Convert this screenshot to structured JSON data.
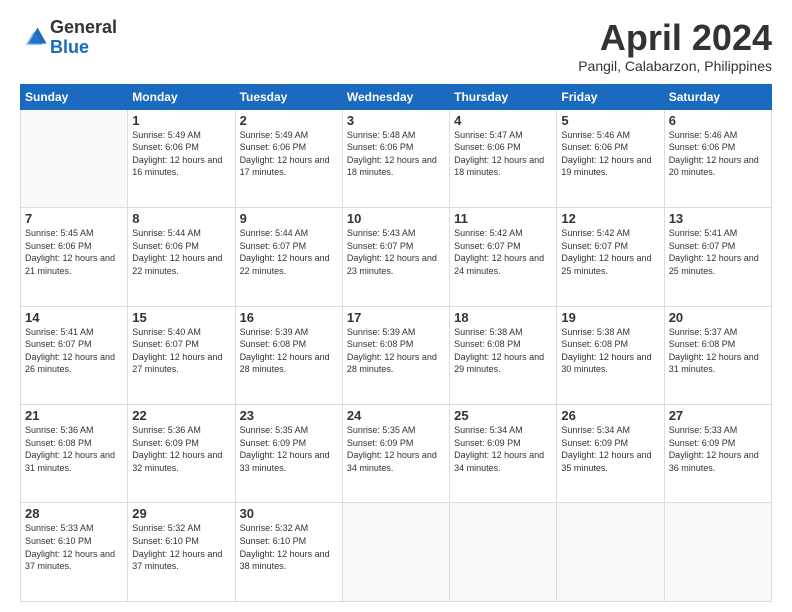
{
  "header": {
    "logo_general": "General",
    "logo_blue": "Blue",
    "month_title": "April 2024",
    "location": "Pangil, Calabarzon, Philippines"
  },
  "weekdays": [
    "Sunday",
    "Monday",
    "Tuesday",
    "Wednesday",
    "Thursday",
    "Friday",
    "Saturday"
  ],
  "weeks": [
    [
      {
        "day": "",
        "sunrise": "",
        "sunset": "",
        "daylight": ""
      },
      {
        "day": "1",
        "sunrise": "5:49 AM",
        "sunset": "6:06 PM",
        "daylight": "12 hours and 16 minutes."
      },
      {
        "day": "2",
        "sunrise": "5:49 AM",
        "sunset": "6:06 PM",
        "daylight": "12 hours and 17 minutes."
      },
      {
        "day": "3",
        "sunrise": "5:48 AM",
        "sunset": "6:06 PM",
        "daylight": "12 hours and 18 minutes."
      },
      {
        "day": "4",
        "sunrise": "5:47 AM",
        "sunset": "6:06 PM",
        "daylight": "12 hours and 18 minutes."
      },
      {
        "day": "5",
        "sunrise": "5:46 AM",
        "sunset": "6:06 PM",
        "daylight": "12 hours and 19 minutes."
      },
      {
        "day": "6",
        "sunrise": "5:46 AM",
        "sunset": "6:06 PM",
        "daylight": "12 hours and 20 minutes."
      }
    ],
    [
      {
        "day": "7",
        "sunrise": "5:45 AM",
        "sunset": "6:06 PM",
        "daylight": "12 hours and 21 minutes."
      },
      {
        "day": "8",
        "sunrise": "5:44 AM",
        "sunset": "6:06 PM",
        "daylight": "12 hours and 22 minutes."
      },
      {
        "day": "9",
        "sunrise": "5:44 AM",
        "sunset": "6:07 PM",
        "daylight": "12 hours and 22 minutes."
      },
      {
        "day": "10",
        "sunrise": "5:43 AM",
        "sunset": "6:07 PM",
        "daylight": "12 hours and 23 minutes."
      },
      {
        "day": "11",
        "sunrise": "5:42 AM",
        "sunset": "6:07 PM",
        "daylight": "12 hours and 24 minutes."
      },
      {
        "day": "12",
        "sunrise": "5:42 AM",
        "sunset": "6:07 PM",
        "daylight": "12 hours and 25 minutes."
      },
      {
        "day": "13",
        "sunrise": "5:41 AM",
        "sunset": "6:07 PM",
        "daylight": "12 hours and 25 minutes."
      }
    ],
    [
      {
        "day": "14",
        "sunrise": "5:41 AM",
        "sunset": "6:07 PM",
        "daylight": "12 hours and 26 minutes."
      },
      {
        "day": "15",
        "sunrise": "5:40 AM",
        "sunset": "6:07 PM",
        "daylight": "12 hours and 27 minutes."
      },
      {
        "day": "16",
        "sunrise": "5:39 AM",
        "sunset": "6:08 PM",
        "daylight": "12 hours and 28 minutes."
      },
      {
        "day": "17",
        "sunrise": "5:39 AM",
        "sunset": "6:08 PM",
        "daylight": "12 hours and 28 minutes."
      },
      {
        "day": "18",
        "sunrise": "5:38 AM",
        "sunset": "6:08 PM",
        "daylight": "12 hours and 29 minutes."
      },
      {
        "day": "19",
        "sunrise": "5:38 AM",
        "sunset": "6:08 PM",
        "daylight": "12 hours and 30 minutes."
      },
      {
        "day": "20",
        "sunrise": "5:37 AM",
        "sunset": "6:08 PM",
        "daylight": "12 hours and 31 minutes."
      }
    ],
    [
      {
        "day": "21",
        "sunrise": "5:36 AM",
        "sunset": "6:08 PM",
        "daylight": "12 hours and 31 minutes."
      },
      {
        "day": "22",
        "sunrise": "5:36 AM",
        "sunset": "6:09 PM",
        "daylight": "12 hours and 32 minutes."
      },
      {
        "day": "23",
        "sunrise": "5:35 AM",
        "sunset": "6:09 PM",
        "daylight": "12 hours and 33 minutes."
      },
      {
        "day": "24",
        "sunrise": "5:35 AM",
        "sunset": "6:09 PM",
        "daylight": "12 hours and 34 minutes."
      },
      {
        "day": "25",
        "sunrise": "5:34 AM",
        "sunset": "6:09 PM",
        "daylight": "12 hours and 34 minutes."
      },
      {
        "day": "26",
        "sunrise": "5:34 AM",
        "sunset": "6:09 PM",
        "daylight": "12 hours and 35 minutes."
      },
      {
        "day": "27",
        "sunrise": "5:33 AM",
        "sunset": "6:09 PM",
        "daylight": "12 hours and 36 minutes."
      }
    ],
    [
      {
        "day": "28",
        "sunrise": "5:33 AM",
        "sunset": "6:10 PM",
        "daylight": "12 hours and 37 minutes."
      },
      {
        "day": "29",
        "sunrise": "5:32 AM",
        "sunset": "6:10 PM",
        "daylight": "12 hours and 37 minutes."
      },
      {
        "day": "30",
        "sunrise": "5:32 AM",
        "sunset": "6:10 PM",
        "daylight": "12 hours and 38 minutes."
      },
      {
        "day": "",
        "sunrise": "",
        "sunset": "",
        "daylight": ""
      },
      {
        "day": "",
        "sunrise": "",
        "sunset": "",
        "daylight": ""
      },
      {
        "day": "",
        "sunrise": "",
        "sunset": "",
        "daylight": ""
      },
      {
        "day": "",
        "sunrise": "",
        "sunset": "",
        "daylight": ""
      }
    ]
  ]
}
